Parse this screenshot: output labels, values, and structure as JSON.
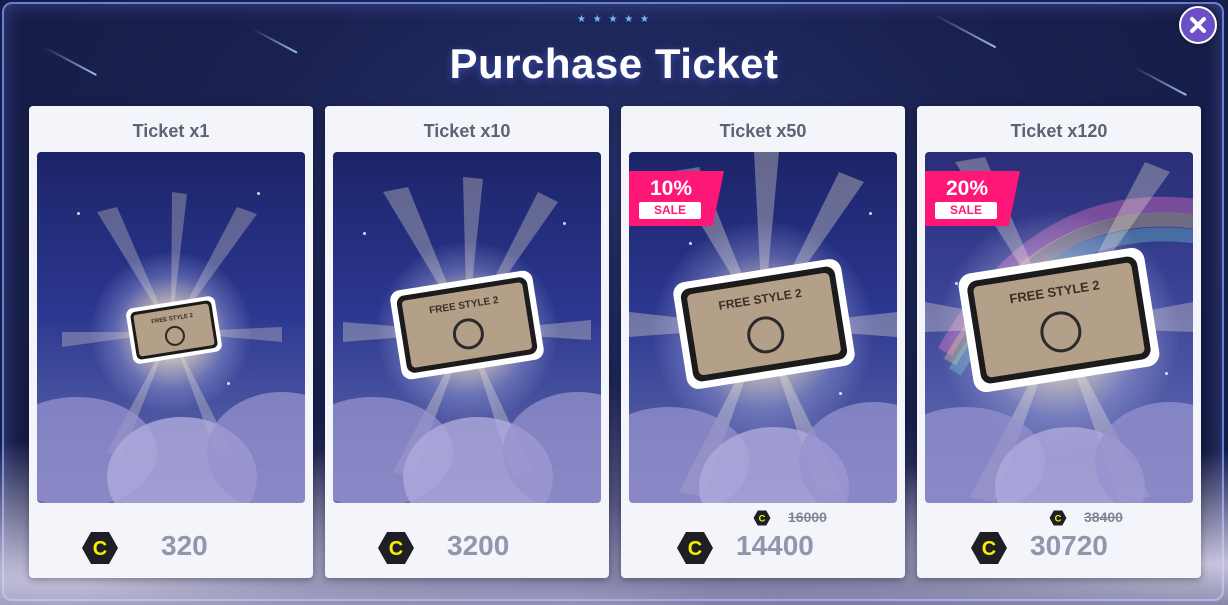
{
  "header": {
    "title": "Purchase Ticket",
    "stars": "★ ★ ★ ★ ★"
  },
  "close_icon": "close-icon",
  "cards": [
    {
      "title": "Ticket x1",
      "ticket_text": "FREE STYLE 2",
      "price": "320",
      "old_price": null,
      "sale_pct": null,
      "sale_label": null
    },
    {
      "title": "Ticket x10",
      "ticket_text": "FREE STYLE 2",
      "price": "3200",
      "old_price": null,
      "sale_pct": null,
      "sale_label": null
    },
    {
      "title": "Ticket x50",
      "ticket_text": "FREE STYLE 2",
      "price": "14400",
      "old_price": "16000",
      "sale_pct": "10%",
      "sale_label": "SALE"
    },
    {
      "title": "Ticket x120",
      "ticket_text": "FREE STYLE 2",
      "price": "30720",
      "old_price": "38400",
      "sale_pct": "20%",
      "sale_label": "SALE"
    }
  ],
  "currency_icon": "coin-c-icon",
  "colors": {
    "sale": "#ff1777",
    "coin_yellow": "#f5ef00",
    "coin_dark": "#1e1e24",
    "close_purple": "#6b4fc6"
  }
}
